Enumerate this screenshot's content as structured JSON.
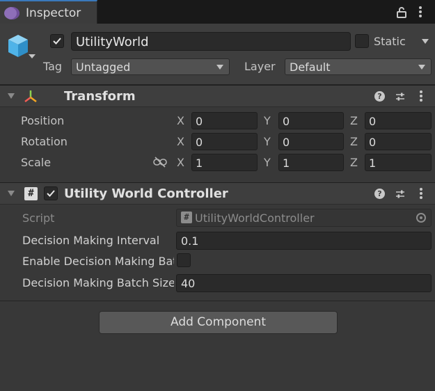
{
  "tab": {
    "label": "Inspector"
  },
  "gameobject": {
    "name": "UtilityWorld",
    "static_label": "Static",
    "tag_label": "Tag",
    "tag_value": "Untagged",
    "layer_label": "Layer",
    "layer_value": "Default"
  },
  "transform": {
    "title": "Transform",
    "rows": [
      {
        "label": "Position",
        "x": "0",
        "y": "0",
        "z": "0"
      },
      {
        "label": "Rotation",
        "x": "0",
        "y": "0",
        "z": "0"
      },
      {
        "label": "Scale",
        "x": "1",
        "y": "1",
        "z": "1"
      }
    ],
    "axes": {
      "x": "X",
      "y": "Y",
      "z": "Z"
    }
  },
  "controller": {
    "title": "Utility World Controller",
    "script_label": "Script",
    "script_value": "UtilityWorldController",
    "interval_label": "Decision Making Interval",
    "interval_value": "0.1",
    "batch_enable_label": "Enable Decision Making Batching",
    "batch_size_label": "Decision Making Batch Size",
    "batch_size_value": "40"
  },
  "add_component_label": "Add Component",
  "icons": {
    "tab": "gameobject-icon",
    "lock": "lock-icon",
    "menu": "kebab-menu-icon",
    "object": "cube-icon",
    "transform": "transform-axes-icon",
    "script": "csharp-script-icon",
    "help": "help-icon",
    "presets": "presets-icon",
    "scale_link": "unlinked-scale-icon",
    "picker": "object-picker-icon"
  },
  "colors": {
    "accent": "#3a79bb",
    "cube": "#4fb3e8",
    "panel": "#383838"
  }
}
